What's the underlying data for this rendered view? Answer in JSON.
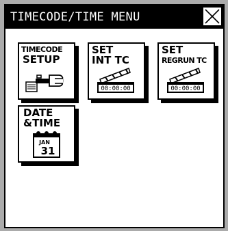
{
  "window": {
    "title": "TIMECODE/TIME MENU",
    "close_icon": "close-icon"
  },
  "tiles": [
    {
      "line1": "TIMECODE",
      "line2": "SETUP",
      "icon": "wrench-icon"
    },
    {
      "line1": "SET",
      "line2": "INT TC",
      "icon": "clapperboard-icon",
      "display": "00:00:00"
    },
    {
      "line1": "SET",
      "line2": "REGRUN TC",
      "icon": "clapperboard-icon",
      "display": "00:00:00"
    },
    {
      "line1": "DATE",
      "line2": "&TIME",
      "icon": "calendar-icon",
      "month": "JAN",
      "day": "31"
    }
  ]
}
